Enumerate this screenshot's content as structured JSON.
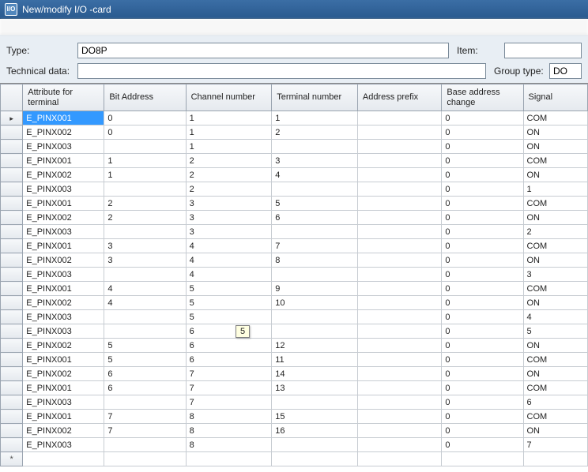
{
  "window": {
    "title": "New/modify I/O -card",
    "icon_label": "I/O"
  },
  "form": {
    "type_label": "Type:",
    "type_value": "DO8P",
    "item_label": "Item:",
    "item_value": "",
    "techdata_label": "Technical data:",
    "techdata_value": "",
    "grouptype_label": "Group type:",
    "grouptype_value": "DO"
  },
  "columns": {
    "attr": "Attribute for terminal",
    "bit": "Bit Address",
    "chan": "Channel number",
    "term": "Terminal number",
    "prefix": "Address prefix",
    "base": "Base address change",
    "sig": "Signal"
  },
  "tooltip": "5",
  "rows": [
    {
      "sel": true,
      "attr": "E_PINX001",
      "bit": "0",
      "chan": "1",
      "term": "1",
      "prefix": "",
      "base": "0",
      "sig": "COM"
    },
    {
      "attr": "E_PINX002",
      "bit": "0",
      "chan": "1",
      "term": "2",
      "prefix": "",
      "base": "0",
      "sig": "ON"
    },
    {
      "attr": "E_PINX003",
      "bit": "",
      "chan": "1",
      "term": "",
      "prefix": "",
      "base": "0",
      "sig": "ON"
    },
    {
      "attr": "E_PINX001",
      "bit": "1",
      "chan": "2",
      "term": "3",
      "prefix": "",
      "base": "0",
      "sig": "COM"
    },
    {
      "attr": "E_PINX002",
      "bit": "1",
      "chan": "2",
      "term": "4",
      "prefix": "",
      "base": "0",
      "sig": "ON"
    },
    {
      "attr": "E_PINX003",
      "bit": "",
      "chan": "2",
      "term": "",
      "prefix": "",
      "base": "0",
      "sig": "1"
    },
    {
      "attr": "E_PINX001",
      "bit": "2",
      "chan": "3",
      "term": "5",
      "prefix": "",
      "base": "0",
      "sig": "COM"
    },
    {
      "attr": "E_PINX002",
      "bit": "2",
      "chan": "3",
      "term": "6",
      "prefix": "",
      "base": "0",
      "sig": "ON"
    },
    {
      "attr": "E_PINX003",
      "bit": "",
      "chan": "3",
      "term": "",
      "prefix": "",
      "base": "0",
      "sig": "2"
    },
    {
      "attr": "E_PINX001",
      "bit": "3",
      "chan": "4",
      "term": "7",
      "prefix": "",
      "base": "0",
      "sig": "COM"
    },
    {
      "attr": "E_PINX002",
      "bit": "3",
      "chan": "4",
      "term": "8",
      "prefix": "",
      "base": "0",
      "sig": "ON"
    },
    {
      "attr": "E_PINX003",
      "bit": "",
      "chan": "4",
      "term": "",
      "prefix": "",
      "base": "0",
      "sig": "3"
    },
    {
      "attr": "E_PINX001",
      "bit": "4",
      "chan": "5",
      "term": "9",
      "prefix": "",
      "base": "0",
      "sig": "COM"
    },
    {
      "attr": "E_PINX002",
      "bit": "4",
      "chan": "5",
      "term": "10",
      "prefix": "",
      "base": "0",
      "sig": "ON"
    },
    {
      "attr": "E_PINX003",
      "bit": "",
      "chan": "5",
      "term": "",
      "prefix": "",
      "base": "0",
      "sig": "4"
    },
    {
      "attr": "E_PINX003",
      "bit": "",
      "chan": "6",
      "term": "",
      "prefix": "",
      "base": "0",
      "sig": "5"
    },
    {
      "attr": "E_PINX002",
      "bit": "5",
      "chan": "6",
      "term": "12",
      "prefix": "",
      "base": "0",
      "sig": "ON"
    },
    {
      "attr": "E_PINX001",
      "bit": "5",
      "chan": "6",
      "term": "11",
      "prefix": "",
      "base": "0",
      "sig": "COM"
    },
    {
      "attr": "E_PINX002",
      "bit": "6",
      "chan": "7",
      "term": "14",
      "prefix": "",
      "base": "0",
      "sig": "ON"
    },
    {
      "attr": "E_PINX001",
      "bit": "6",
      "chan": "7",
      "term": "13",
      "prefix": "",
      "base": "0",
      "sig": "COM"
    },
    {
      "attr": "E_PINX003",
      "bit": "",
      "chan": "7",
      "term": "",
      "prefix": "",
      "base": "0",
      "sig": "6"
    },
    {
      "attr": "E_PINX001",
      "bit": "7",
      "chan": "8",
      "term": "15",
      "prefix": "",
      "base": "0",
      "sig": "COM"
    },
    {
      "attr": "E_PINX002",
      "bit": "7",
      "chan": "8",
      "term": "16",
      "prefix": "",
      "base": "0",
      "sig": "ON"
    },
    {
      "attr": "E_PINX003",
      "bit": "",
      "chan": "8",
      "term": "",
      "prefix": "",
      "base": "0",
      "sig": "7"
    }
  ]
}
